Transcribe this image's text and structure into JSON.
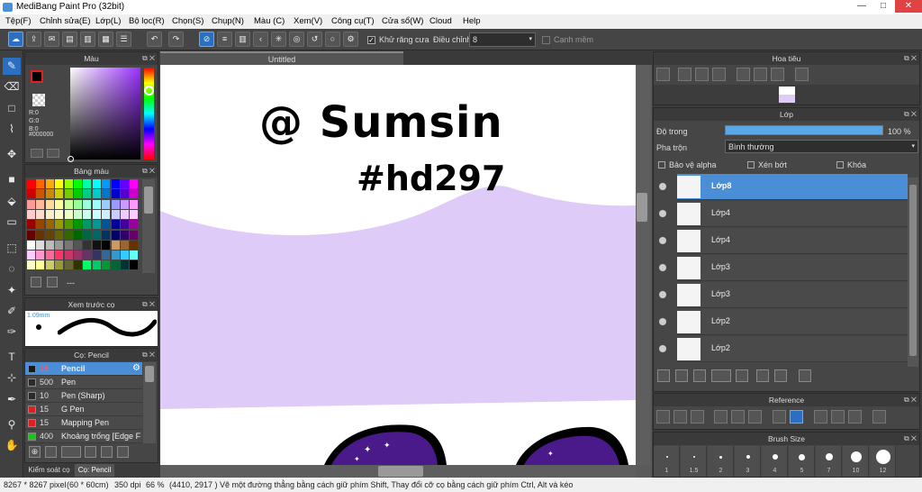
{
  "window": {
    "title": "MediBang Paint Pro (32bit)",
    "minimize": "—",
    "maximize": "□",
    "close": "✕"
  },
  "menu": [
    "Tệp(F)",
    "Chỉnh sửa(E)",
    "Lớp(L)",
    "Bộ lọc(R)",
    "Chọn(S)",
    "Chụp(N)",
    "Màu (C)",
    "Xem(V)",
    "Công cụ(T)",
    "Cửa sổ(W)",
    "Cloud",
    "Help"
  ],
  "toolbar": {
    "antialias_label": "Khử răng cưa",
    "adjust_label": "Điều chỉnh",
    "adjust_value": "8",
    "soft_edge_label": "Cạnh mềm"
  },
  "color_panel": {
    "title": "Màu",
    "r": "R:0",
    "g": "G:0",
    "b": "B:0",
    "hex": "#000000",
    "primary": "#000000"
  },
  "palette_panel": {
    "title": "Bảng màu",
    "more": "---"
  },
  "brush_preview": {
    "title": "Xem trước cọ",
    "size": "1.09mm"
  },
  "brush_panel": {
    "title": "Cọ: Pencil",
    "items": [
      {
        "size": "15",
        "name": "Pencil",
        "color": "#1a1a1a",
        "selected": true
      },
      {
        "size": "500",
        "name": "Pen",
        "color": "#2a2a2a",
        "selected": false
      },
      {
        "size": "10",
        "name": "Pen (Sharp)",
        "color": "#2a2a2a",
        "selected": false
      },
      {
        "size": "15",
        "name": "G Pen",
        "color": "#e02020",
        "selected": false
      },
      {
        "size": "15",
        "name": "Mapping Pen",
        "color": "#e02020",
        "selected": false
      },
      {
        "size": "400",
        "name": "Khoảng trống [Edge F",
        "color": "#20c020",
        "selected": false
      }
    ]
  },
  "bottom_tabs": [
    "Kiểm soát cọ",
    "Cọ: Pencil"
  ],
  "canvas": {
    "tab": "Untitled",
    "text_line1": "@ Sumsin",
    "text_line2": "#hd297"
  },
  "navigator": {
    "title": "Hoa tiêu"
  },
  "layer_panel": {
    "title": "Lớp",
    "opacity_label": "Độ trong",
    "opacity_value": "100 %",
    "opacity": 100,
    "blend_label": "Pha trộn",
    "blend_value": "Bình thường",
    "protect_alpha": "Bảo vệ alpha",
    "clip": "Xén bớt",
    "lock": "Khóa",
    "layers": [
      {
        "name": "Lớp8",
        "selected": true
      },
      {
        "name": "Lớp4",
        "selected": false
      },
      {
        "name": "Lớp4",
        "selected": false
      },
      {
        "name": "Lớp3",
        "selected": false
      },
      {
        "name": "Lớp3",
        "selected": false
      },
      {
        "name": "Lớp2",
        "selected": false
      },
      {
        "name": "Lớp2",
        "selected": false
      }
    ]
  },
  "reference_panel": {
    "title": "Reference"
  },
  "brush_size_panel": {
    "title": "Brush Size",
    "sizes": [
      "1",
      "1.5",
      "2",
      "3",
      "4",
      "5",
      "7",
      "10",
      "12"
    ]
  },
  "status": {
    "dimensions": "8267 * 8267 pixel",
    "physical": "(60 * 60cm)",
    "dpi": "350 dpi",
    "zoom": "66 %",
    "coords": "(4410, 2917 )",
    "hint": "Vẽ một đường thẳng bằng cách giữ phím Shift, Thay đổi cỡ cọ bằng cách giữ phím Ctrl, Alt và kéo"
  },
  "colors": {
    "accent": "#4a8ed8",
    "canvas_lavender": "#dfcbf7",
    "space_purple": "#4a1a8a"
  }
}
